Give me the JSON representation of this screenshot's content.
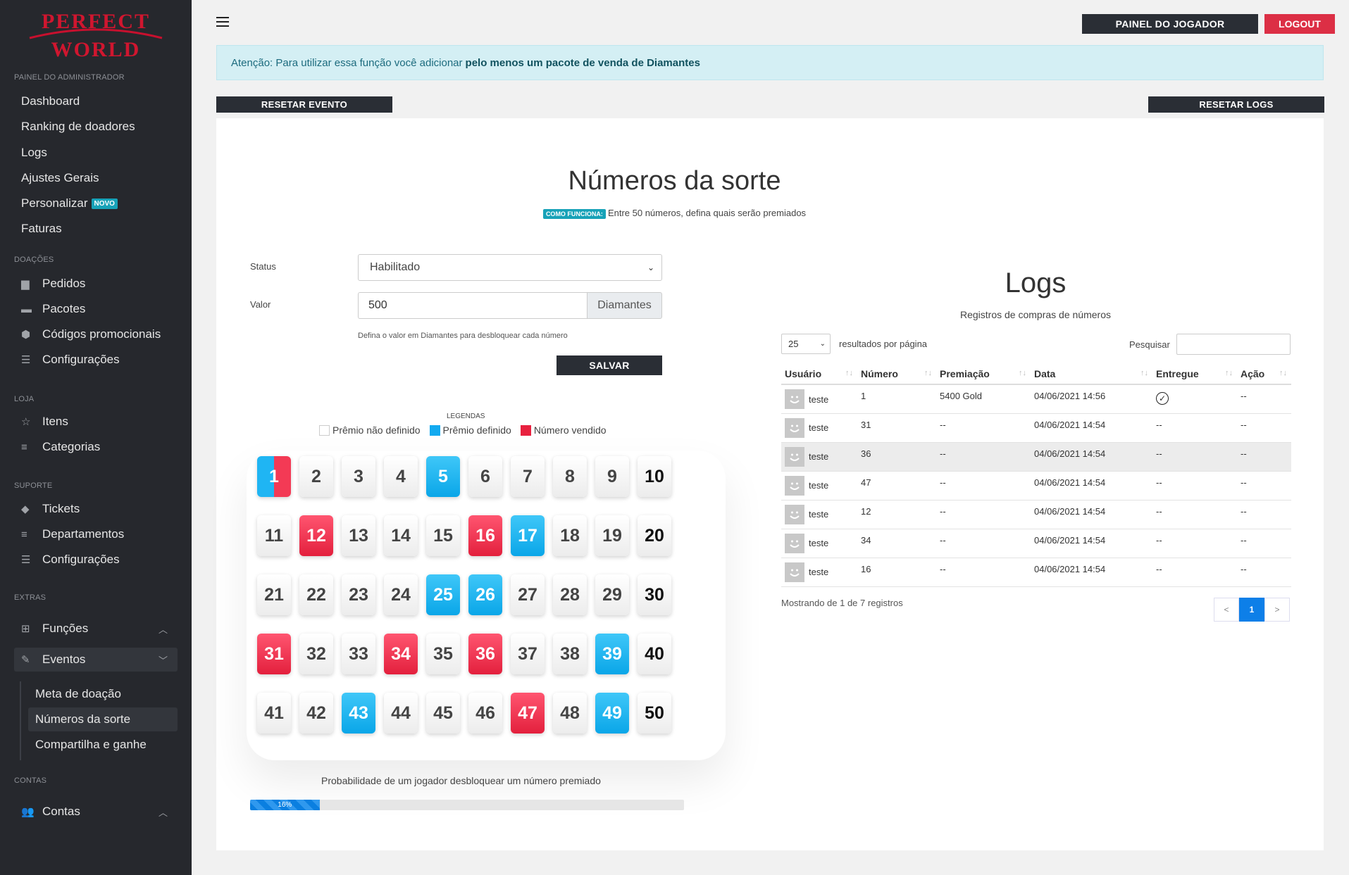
{
  "logo": {
    "line1": "PERFECT",
    "line2": "WORLD"
  },
  "sidebar": {
    "sections": {
      "admin": "PAINEL DO ADMINISTRADOR",
      "doacoes": "DOAÇÕES",
      "loja": "LOJA",
      "suporte": "SUPORTE",
      "extras": "EXTRAS",
      "contas": "CONTAS"
    },
    "admin_items": [
      "Dashboard",
      "Ranking de doadores",
      "Logs",
      "Ajustes Gerais",
      "Personalizar",
      "Faturas"
    ],
    "novo_badge": "NOVO",
    "doacoes_items": [
      "Pedidos",
      "Pacotes",
      "Códigos promocionais",
      "Configurações"
    ],
    "loja_items": [
      "Itens",
      "Categorias"
    ],
    "suporte_items": [
      "Tickets",
      "Departamentos",
      "Configurações"
    ],
    "extras_items": [
      "Funções",
      "Eventos"
    ],
    "eventos_sub": [
      "Meta de doação",
      "Números da sorte",
      "Compartilha e ganhe"
    ],
    "contas_items": [
      "Contas"
    ]
  },
  "topbar": {
    "player_panel": "PAINEL DO JOGADOR",
    "logout": "LOGOUT"
  },
  "alert": {
    "text": "Atenção: Para utilizar essa função você adicionar",
    "bold": "pelo menos um pacote de venda de Diamantes"
  },
  "actions": {
    "reset_event": "RESETAR EVENTO",
    "reset_logs": "RESETAR LOGS"
  },
  "page": {
    "title": "Números da sorte",
    "how_badge": "COMO FUNCIONA:",
    "subtitle": "Entre 50 números, defina quais serão premiados"
  },
  "form": {
    "status_label": "Status",
    "status_value": "Habilitado",
    "valor_label": "Valor",
    "valor_value": "500",
    "valor_addon": "Diamantes",
    "help": "Defina o valor em Diamantes para desbloquear cada número",
    "save": "SALVAR"
  },
  "legend": {
    "title": "LEGENDAS",
    "not_defined": "Prêmio não definido",
    "defined": "Prêmio definido",
    "sold": "Número vendido",
    "colors": {
      "defined": "#13aaf0",
      "sold": "#e8213f"
    }
  },
  "numbers": {
    "half": [
      1
    ],
    "blue": [
      5,
      17,
      25,
      26,
      39,
      43,
      49
    ],
    "red": [
      12,
      16,
      31,
      34,
      36,
      47
    ]
  },
  "probability": {
    "label": "Probabilidade de um jogador desbloquear um número premiado",
    "value": "16%",
    "percent": 16
  },
  "logs": {
    "title": "Logs",
    "subtitle": "Registros de compras de números",
    "per_page": "25",
    "per_page_label": "resultados por página",
    "search_label": "Pesquisar",
    "columns": [
      "Usuário",
      "Número",
      "Premiação",
      "Data",
      "Entregue",
      "Ação"
    ],
    "rows": [
      {
        "user": "teste",
        "num": "1",
        "prize": "5400 Gold",
        "date": "04/06/2021 14:56",
        "delivered": "check",
        "action": "--"
      },
      {
        "user": "teste",
        "num": "31",
        "prize": "--",
        "date": "04/06/2021 14:54",
        "delivered": "--",
        "action": "--"
      },
      {
        "user": "teste",
        "num": "36",
        "prize": "--",
        "date": "04/06/2021 14:54",
        "delivered": "--",
        "action": "--"
      },
      {
        "user": "teste",
        "num": "47",
        "prize": "--",
        "date": "04/06/2021 14:54",
        "delivered": "--",
        "action": "--"
      },
      {
        "user": "teste",
        "num": "12",
        "prize": "--",
        "date": "04/06/2021 14:54",
        "delivered": "--",
        "action": "--"
      },
      {
        "user": "teste",
        "num": "34",
        "prize": "--",
        "date": "04/06/2021 14:54",
        "delivered": "--",
        "action": "--"
      },
      {
        "user": "teste",
        "num": "16",
        "prize": "--",
        "date": "04/06/2021 14:54",
        "delivered": "--",
        "action": "--"
      }
    ],
    "showing": "Mostrando de 1 de 7 registros",
    "pager": {
      "prev": "<",
      "current": "1",
      "next": ">"
    }
  }
}
